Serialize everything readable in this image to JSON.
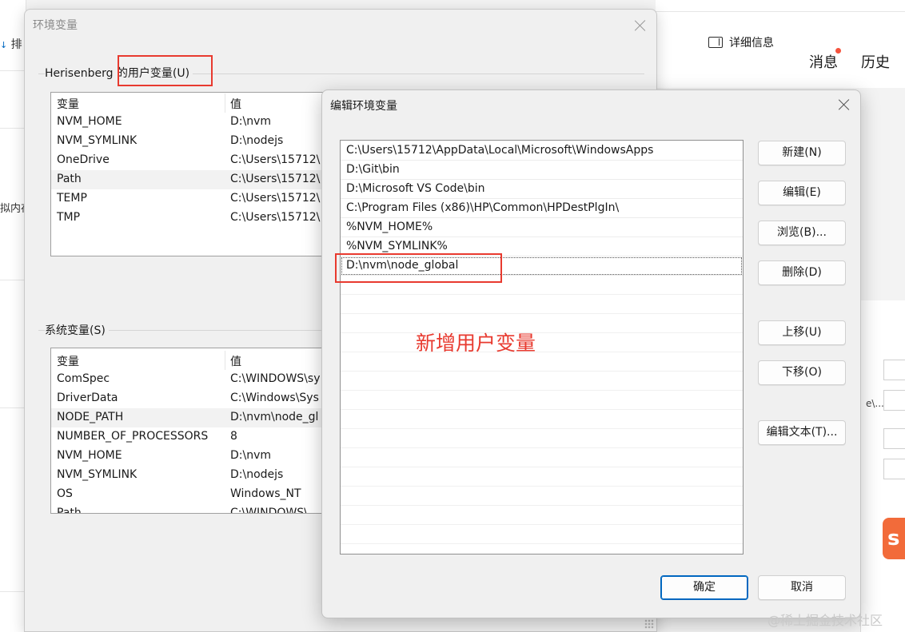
{
  "background": {
    "left_fragments": [
      "排",
      "拟内存"
    ],
    "details_button": "详细信息",
    "tabs": {
      "messages": "消息",
      "history": "历史"
    },
    "right_fragments": [
      "e\\...",
      "s"
    ]
  },
  "env_dialog": {
    "title": "环境变量",
    "user_section": {
      "label_user": "Herisenberg",
      "label_suffix": " 的用户变量(U)",
      "columns": [
        "变量",
        "值"
      ],
      "rows": [
        {
          "name": "NVM_HOME",
          "value": "D:\\nvm"
        },
        {
          "name": "NVM_SYMLINK",
          "value": "D:\\nodejs"
        },
        {
          "name": "OneDrive",
          "value": "C:\\Users\\15712\\"
        },
        {
          "name": "Path",
          "value": "C:\\Users\\15712\\"
        },
        {
          "name": "TEMP",
          "value": "C:\\Users\\15712\\"
        },
        {
          "name": "TMP",
          "value": "C:\\Users\\15712\\"
        }
      ]
    },
    "system_section": {
      "label": "系统变量(S)",
      "columns": [
        "变量",
        "值"
      ],
      "rows": [
        {
          "name": "ComSpec",
          "value": "C:\\WINDOWS\\sy"
        },
        {
          "name": "DriverData",
          "value": "C:\\Windows\\Sys"
        },
        {
          "name": "NODE_PATH",
          "value": "D:\\nvm\\node_gl"
        },
        {
          "name": "NUMBER_OF_PROCESSORS",
          "value": "8"
        },
        {
          "name": "NVM_HOME",
          "value": "D:\\nvm"
        },
        {
          "name": "NVM_SYMLINK",
          "value": "D:\\nodejs"
        },
        {
          "name": "OS",
          "value": "Windows_NT"
        },
        {
          "name": "Path",
          "value": "C:\\WINDOWS\\"
        }
      ]
    }
  },
  "edit_dialog": {
    "title": "编辑环境变量",
    "paths": [
      "C:\\Users\\15712\\AppData\\Local\\Microsoft\\WindowsApps",
      "D:\\Git\\bin",
      "D:\\Microsoft VS Code\\bin",
      "C:\\Program Files (x86)\\HP\\Common\\HPDestPlgIn\\",
      "%NVM_HOME%",
      "%NVM_SYMLINK%",
      "D:\\nvm\\node_global"
    ],
    "buttons": {
      "new": "新建(N)",
      "edit": "编辑(E)",
      "browse": "浏览(B)...",
      "delete": "删除(D)",
      "move_up": "上移(U)",
      "move_down": "下移(O)",
      "edit_text": "编辑文本(T)...",
      "ok": "确定",
      "cancel": "取消"
    }
  },
  "annotation": {
    "text": "新增用户变量",
    "color": "#e83a2f"
  },
  "watermark": "@稀土掘金技术社区"
}
